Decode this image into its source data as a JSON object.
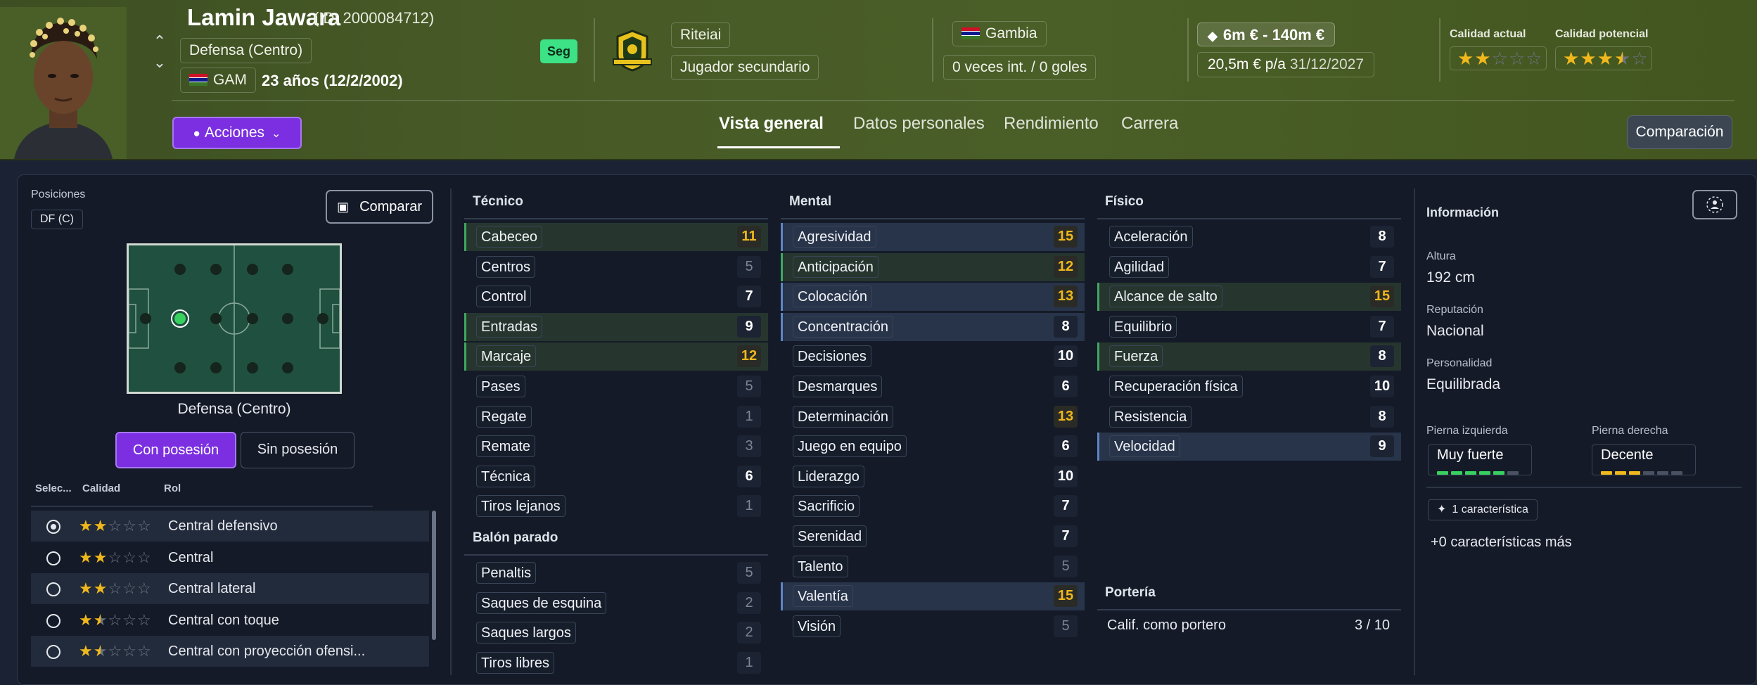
{
  "header": {
    "player_name": "Lamin Jawara",
    "player_id": "(ID: 2000084712)",
    "position": "Defensa (Centro)",
    "nationality_code": "GAM",
    "age": "23 años (12/2/2002)",
    "badge": "Seg",
    "club": "Riteiai",
    "squad_role": "Jugador secundario",
    "country": "Gambia",
    "international": "0 veces int. / 0 goles",
    "value_range": "6m € - 140m €",
    "salary": "20,5m € p/a",
    "contract_end": "31/12/2027",
    "current_quality_label": "Calidad actual",
    "current_quality_stars": 2,
    "potential_quality_label": "Calidad potencial",
    "potential_quality_stars": 3.5,
    "actions_button": "Acciones",
    "compare_button": "Comparación",
    "tabs": [
      "Vista general",
      "Datos personales",
      "Rendimiento",
      "Carrera"
    ],
    "active_tab": "Vista general"
  },
  "positions": {
    "label": "Posiciones",
    "chip": "DF (C)",
    "compare_button": "Comparar",
    "pitch_caption": "Defensa (Centro)",
    "with_ball": "Con posesión",
    "without_ball": "Sin posesión",
    "role_headers": [
      "Selec...",
      "Calidad",
      "Rol"
    ],
    "roles": [
      {
        "name": "Central defensivo",
        "stars": 2,
        "selected": true
      },
      {
        "name": "Central",
        "stars": 2,
        "selected": false
      },
      {
        "name": "Central lateral",
        "stars": 2,
        "selected": false
      },
      {
        "name": "Central con toque",
        "stars": 1.5,
        "selected": false
      },
      {
        "name": "Central con proyección ofensi...",
        "stars": 1.5,
        "selected": false
      }
    ]
  },
  "technical": {
    "title": "Técnico",
    "attrs": [
      {
        "name": "Cabeceo",
        "value": 11,
        "hl": "g",
        "tone": "y"
      },
      {
        "name": "Centros",
        "value": 5,
        "hl": "",
        "tone": "d"
      },
      {
        "name": "Control",
        "value": 7,
        "hl": "",
        "tone": "w"
      },
      {
        "name": "Entradas",
        "value": 9,
        "hl": "g",
        "tone": "w"
      },
      {
        "name": "Marcaje",
        "value": 12,
        "hl": "g",
        "tone": "y"
      },
      {
        "name": "Pases",
        "value": 5,
        "hl": "",
        "tone": "d"
      },
      {
        "name": "Regate",
        "value": 1,
        "hl": "",
        "tone": "d"
      },
      {
        "name": "Remate",
        "value": 3,
        "hl": "",
        "tone": "d"
      },
      {
        "name": "Técnica",
        "value": 6,
        "hl": "",
        "tone": "w"
      },
      {
        "name": "Tiros lejanos",
        "value": 1,
        "hl": "",
        "tone": "d"
      }
    ]
  },
  "set_pieces": {
    "title": "Balón parado",
    "attrs": [
      {
        "name": "Penaltis",
        "value": 5,
        "hl": "",
        "tone": "d"
      },
      {
        "name": "Saques de esquina",
        "value": 2,
        "hl": "",
        "tone": "d"
      },
      {
        "name": "Saques largos",
        "value": 2,
        "hl": "",
        "tone": "d"
      },
      {
        "name": "Tiros libres",
        "value": 1,
        "hl": "",
        "tone": "d"
      }
    ]
  },
  "mental": {
    "title": "Mental",
    "attrs": [
      {
        "name": "Agresividad",
        "value": 15,
        "hl": "b",
        "tone": "y"
      },
      {
        "name": "Anticipación",
        "value": 12,
        "hl": "g",
        "tone": "y"
      },
      {
        "name": "Colocación",
        "value": 13,
        "hl": "b",
        "tone": "y"
      },
      {
        "name": "Concentración",
        "value": 8,
        "hl": "b",
        "tone": "w"
      },
      {
        "name": "Decisiones",
        "value": 10,
        "hl": "",
        "tone": "w"
      },
      {
        "name": "Desmarques",
        "value": 6,
        "hl": "",
        "tone": "w"
      },
      {
        "name": "Determinación",
        "value": 13,
        "hl": "",
        "tone": "y"
      },
      {
        "name": "Juego en equipo",
        "value": 6,
        "hl": "",
        "tone": "w"
      },
      {
        "name": "Liderazgo",
        "value": 10,
        "hl": "",
        "tone": "w"
      },
      {
        "name": "Sacrificio",
        "value": 7,
        "hl": "",
        "tone": "w"
      },
      {
        "name": "Serenidad",
        "value": 7,
        "hl": "",
        "tone": "w"
      },
      {
        "name": "Talento",
        "value": 5,
        "hl": "",
        "tone": "d"
      },
      {
        "name": "Valentía",
        "value": 15,
        "hl": "b",
        "tone": "y"
      },
      {
        "name": "Visión",
        "value": 5,
        "hl": "",
        "tone": "d"
      }
    ]
  },
  "physical": {
    "title": "Físico",
    "attrs": [
      {
        "name": "Aceleración",
        "value": 8,
        "hl": "",
        "tone": "w"
      },
      {
        "name": "Agilidad",
        "value": 7,
        "hl": "",
        "tone": "w"
      },
      {
        "name": "Alcance de salto",
        "value": 15,
        "hl": "g",
        "tone": "y"
      },
      {
        "name": "Equilibrio",
        "value": 7,
        "hl": "",
        "tone": "w"
      },
      {
        "name": "Fuerza",
        "value": 8,
        "hl": "g",
        "tone": "w"
      },
      {
        "name": "Recuperación física",
        "value": 10,
        "hl": "",
        "tone": "w"
      },
      {
        "name": "Resistencia",
        "value": 8,
        "hl": "",
        "tone": "w"
      },
      {
        "name": "Velocidad",
        "value": 9,
        "hl": "b",
        "tone": "w"
      }
    ]
  },
  "goalkeeping": {
    "title": "Portería",
    "label": "Calif. como portero",
    "value": "3 / 10"
  },
  "info": {
    "title": "Información",
    "height_label": "Altura",
    "height": "192 cm",
    "reputation_label": "Reputación",
    "reputation": "Nacional",
    "personality_label": "Personalidad",
    "personality": "Equilibrada",
    "left_foot_label": "Pierna izquierda",
    "left_foot": "Muy fuerte",
    "left_foot_level": 5,
    "right_foot_label": "Pierna derecha",
    "right_foot": "Decente",
    "right_foot_level": 3,
    "traits_chip": "1 característica",
    "traits_more": "+0 características más"
  },
  "colors": {
    "accent_purple": "#7b2fe0",
    "highlight_green": "#3fa860",
    "highlight_blue": "#5e86c4",
    "star_gold": "#f0b81c",
    "foot_green": "#38d160",
    "foot_yellow": "#f0b81c"
  }
}
